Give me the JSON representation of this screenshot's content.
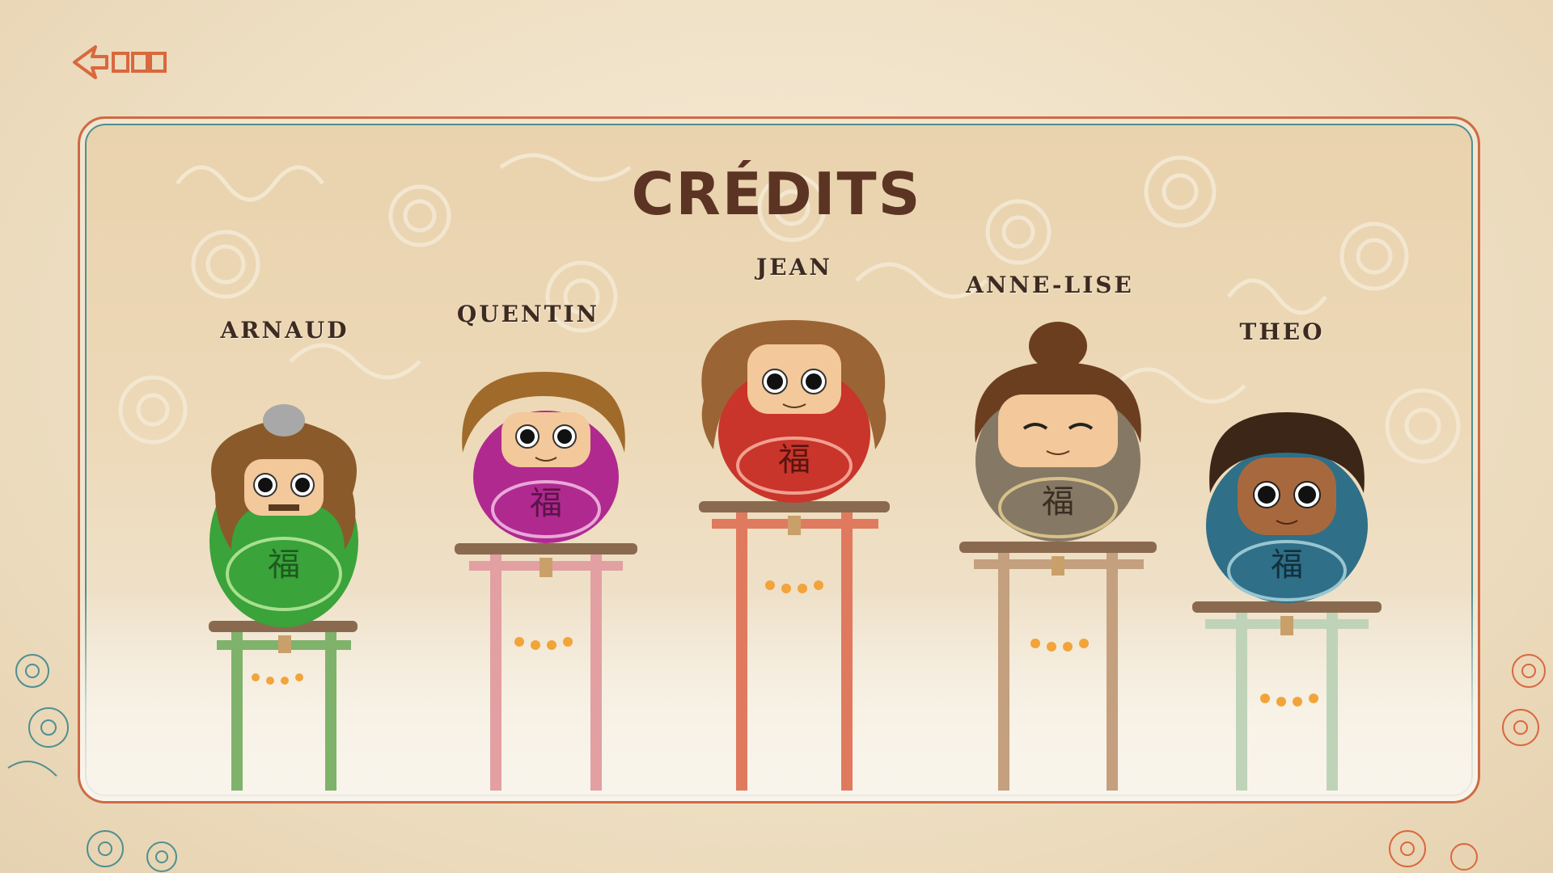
{
  "screen": {
    "title": "CRÉDITS"
  },
  "nav": {
    "back_icon": "back-arrow-logo-icon"
  },
  "colors": {
    "frame_border": "#cf6a45",
    "frame_inner": "#4f8f90",
    "title": "#5b3423"
  },
  "team": [
    {
      "name": "ARNAUD",
      "body_color": "#3aa33a",
      "torii_color": "#7fb26a",
      "hair_color": "#8b5a2b"
    },
    {
      "name": "QUENTIN",
      "body_color": "#b0298f",
      "torii_color": "#e2a0a3",
      "hair_color": "#a06a2a"
    },
    {
      "name": "JEAN",
      "body_color": "#c9352a",
      "torii_color": "#e07a5f",
      "hair_color": "#9a6434"
    },
    {
      "name": "ANNE-LISE",
      "body_color": "#857865",
      "torii_color": "#c4a07f",
      "hair_color": "#6b3e20"
    },
    {
      "name": "THEO",
      "body_color": "#2f6f88",
      "torii_color": "#bfd3b8",
      "hair_color": "#3b2618"
    }
  ]
}
